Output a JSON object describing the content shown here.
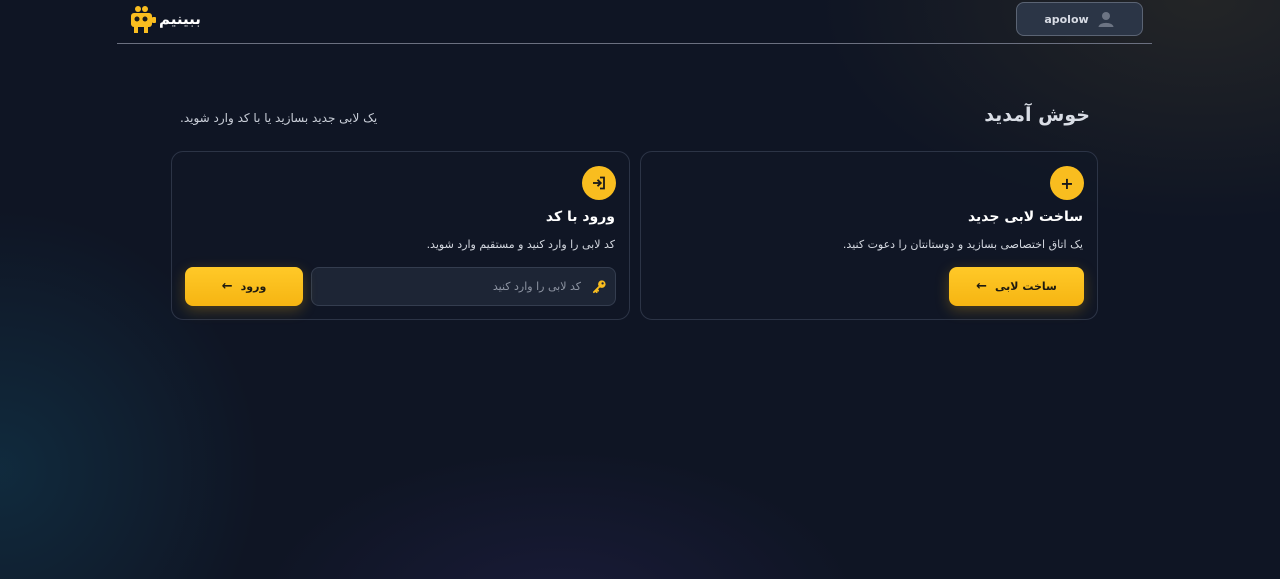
{
  "header": {
    "logo_text": "ببینیم",
    "username": "apolow"
  },
  "welcome": {
    "title": "خوش آمدید",
    "subtitle": "یک لابی جدید بسازید یا با کد وارد شوید."
  },
  "create_card": {
    "icon": "plus-icon",
    "title": "ساخت لابی جدید",
    "description": "یک اتاق اختصاصی بسازید و دوستانتان را دعوت کنید.",
    "button_label": "ساخت لابی",
    "button_arrow": "←"
  },
  "join_card": {
    "icon": "login-icon",
    "title": "ورود با کد",
    "description": "کد لابی را وارد کنید و مستقیم وارد شوید.",
    "input_placeholder": "کد لابی را وارد کنید",
    "input_value": "",
    "button_label": "ورود",
    "button_arrow": "←"
  },
  "colors": {
    "accent": "#f9bd1f",
    "background": "#0f1524",
    "card_border": "#2c3446"
  }
}
